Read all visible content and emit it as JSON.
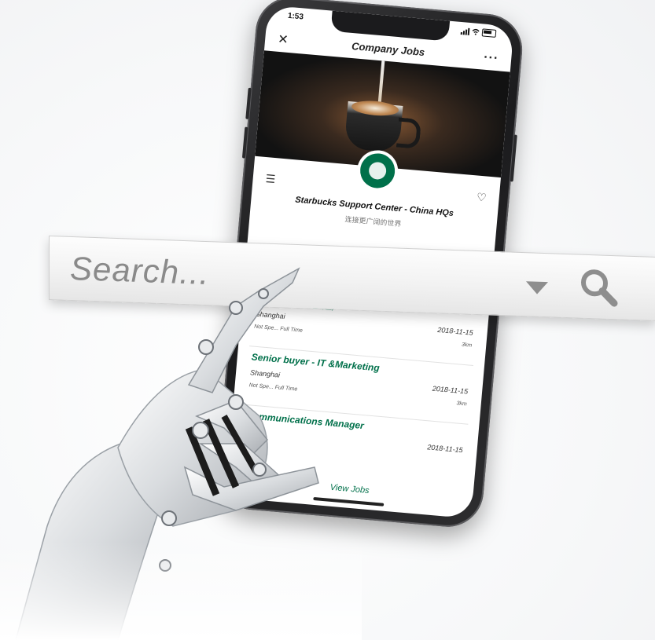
{
  "phone": {
    "status_time": "1:53",
    "nav_title": "Company Jobs",
    "close_glyph": "✕",
    "more_glyph": "···",
    "menu_glyph": "☰",
    "heart_glyph": "♡",
    "company_name": "Starbucks Support Center - China HQs",
    "company_slogan": "连接更广阔的世界",
    "view_jobs_label": "View Jobs",
    "jobs": [
      {
        "title": "运营经理（专星送）",
        "city": "Shanghai",
        "date": "2018-11-15",
        "meta": "Not Spe...  Full Time",
        "distance": "3km"
      },
      {
        "title": "Senior buyer - IT &Marketing",
        "city": "Shanghai",
        "date": "2018-11-15",
        "meta": "Not Spe...  Full Time",
        "distance": "3km"
      },
      {
        "title": "Communications Manager",
        "city": "",
        "date": "2018-11-15",
        "meta": "",
        "distance": ""
      }
    ]
  },
  "search": {
    "placeholder": "Search..."
  },
  "icons": {
    "close": "close-icon",
    "more": "more-icon",
    "menu": "menu-icon",
    "heart": "heart-icon",
    "dropdown": "chevron-down-icon",
    "search": "search-icon",
    "logo": "starbucks-logo"
  },
  "colors": {
    "brand_green": "#00704a",
    "phone_body": "#1b1b1d",
    "search_text": "#8a8a8a"
  }
}
